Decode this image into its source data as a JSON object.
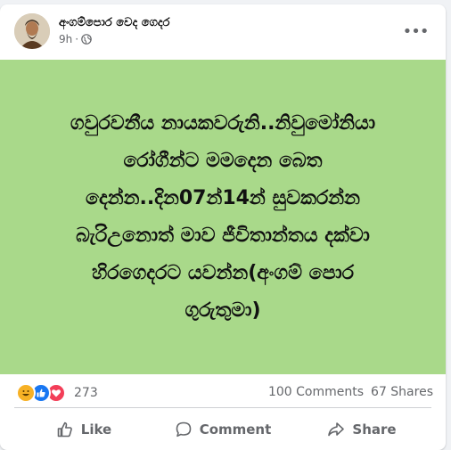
{
  "post": {
    "author": "අංගම්පොර වෙද ගෙදර",
    "time": "9h",
    "privacy_icon": "globe-icon",
    "more_icon": "more-options-icon",
    "more_label": "•••",
    "image_text": "ගවුරවනීය නායකවරුනි..නිවුමෝනියා\nරෝගීන්ට මමදෙන බෙත\nදෙන්න..දින07න්14න් සුවකරන්න\nබැරිඋනොත් මාව ජීවිතාන්තය දක්වා\nහිරගෙදරට යවන්න(අංගම් පොර\nගුරුතුමා)",
    "image_bg": "#a9d98a"
  },
  "stats": {
    "reactions": [
      "haha-icon",
      "like-icon",
      "love-icon"
    ],
    "reaction_count": "273",
    "comments": "100 Comments",
    "shares": "67 Shares"
  },
  "actions": {
    "like_label": "Like",
    "comment_label": "Comment",
    "share_label": "Share"
  },
  "colors": {
    "like_blue": "#1877f2",
    "love_red": "#f33e58",
    "haha_yellow": "#f7b125",
    "secondary_text": "#65676b"
  }
}
